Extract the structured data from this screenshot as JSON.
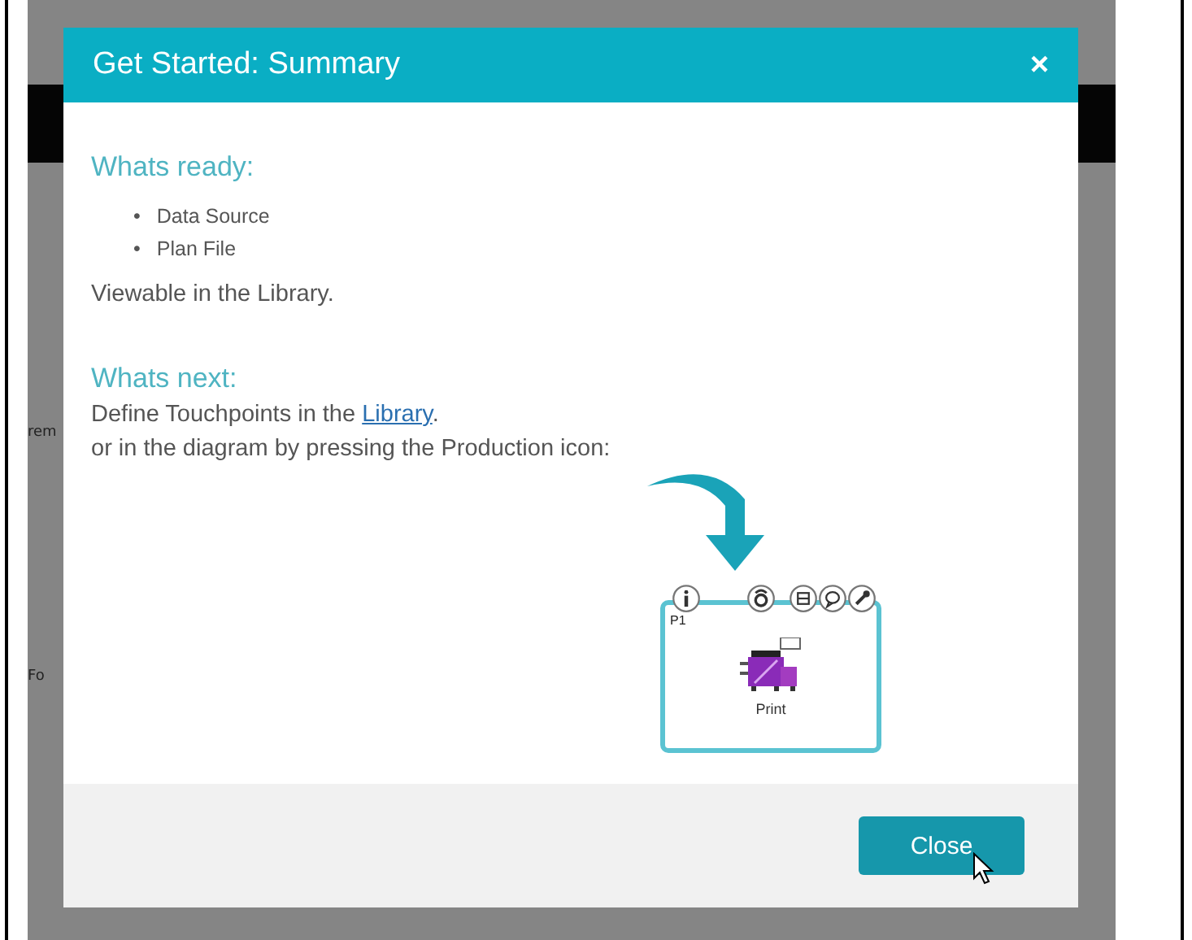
{
  "background": {
    "labels": [
      "rem",
      "Fo"
    ]
  },
  "dialog": {
    "title": "Get Started: Summary",
    "close_glyph": "×",
    "ready_heading": "Whats ready:",
    "ready_items": [
      {
        "bullet": "•",
        "text": "Data Source"
      },
      {
        "bullet": "•",
        "text": "Plan File"
      }
    ],
    "ready_note": "Viewable in the Library.",
    "next_heading": "Whats next:",
    "next_line_1": {
      "before": "Define Touchpoints in the ",
      "link": "Library",
      "after": "."
    },
    "next_line_2": "or in the diagram by pressing the Production icon:",
    "diagram": {
      "node_id": "P1",
      "node_label": "Print"
    },
    "buttons": [
      "Close"
    ]
  }
}
